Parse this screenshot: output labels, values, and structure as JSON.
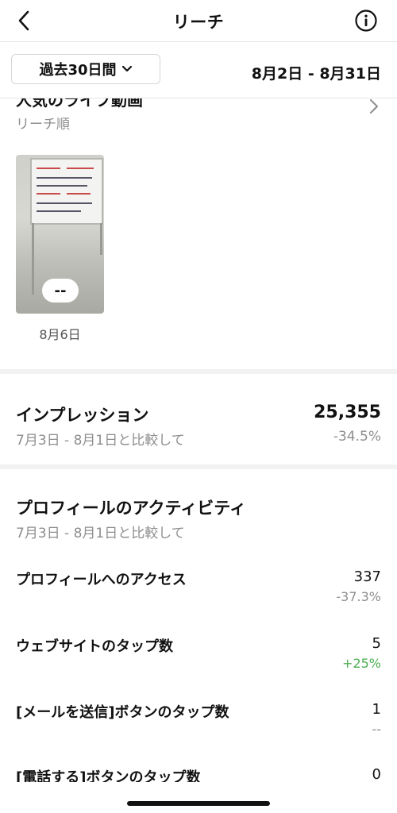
{
  "header": {
    "title": "リーチ",
    "back_icon": "chevron-left-icon",
    "info_icon": "info-icon"
  },
  "range": {
    "selector_label": "過去30日間",
    "dates": "8月2日 - 8月31日"
  },
  "top_videos": {
    "title": "人気のライブ動画",
    "subtitle": "リーチ順",
    "items": [
      {
        "metric": "--",
        "date": "8月6日"
      }
    ]
  },
  "impressions": {
    "title": "インプレッション",
    "compare": "7月3日 - 8月1日と比較して",
    "value": "25,355",
    "change": "-34.5%"
  },
  "profile_activity": {
    "title": "プロフィールのアクティビティ",
    "compare": "7月3日 - 8月1日と比較して",
    "metrics": [
      {
        "label": "プロフィールへのアクセス",
        "value": "337",
        "change": "-37.3%"
      },
      {
        "label": "ウェブサイトのタップ数",
        "value": "5",
        "change": "+25%"
      },
      {
        "label": "[メールを送信]ボタンのタップ数",
        "value": "1",
        "change": "--"
      },
      {
        "label": "[電話する]ボタンのタップ数",
        "value": "0",
        "change": ""
      }
    ]
  },
  "colors": {
    "positive": "#4caf50",
    "muted": "#8e8e8e"
  }
}
